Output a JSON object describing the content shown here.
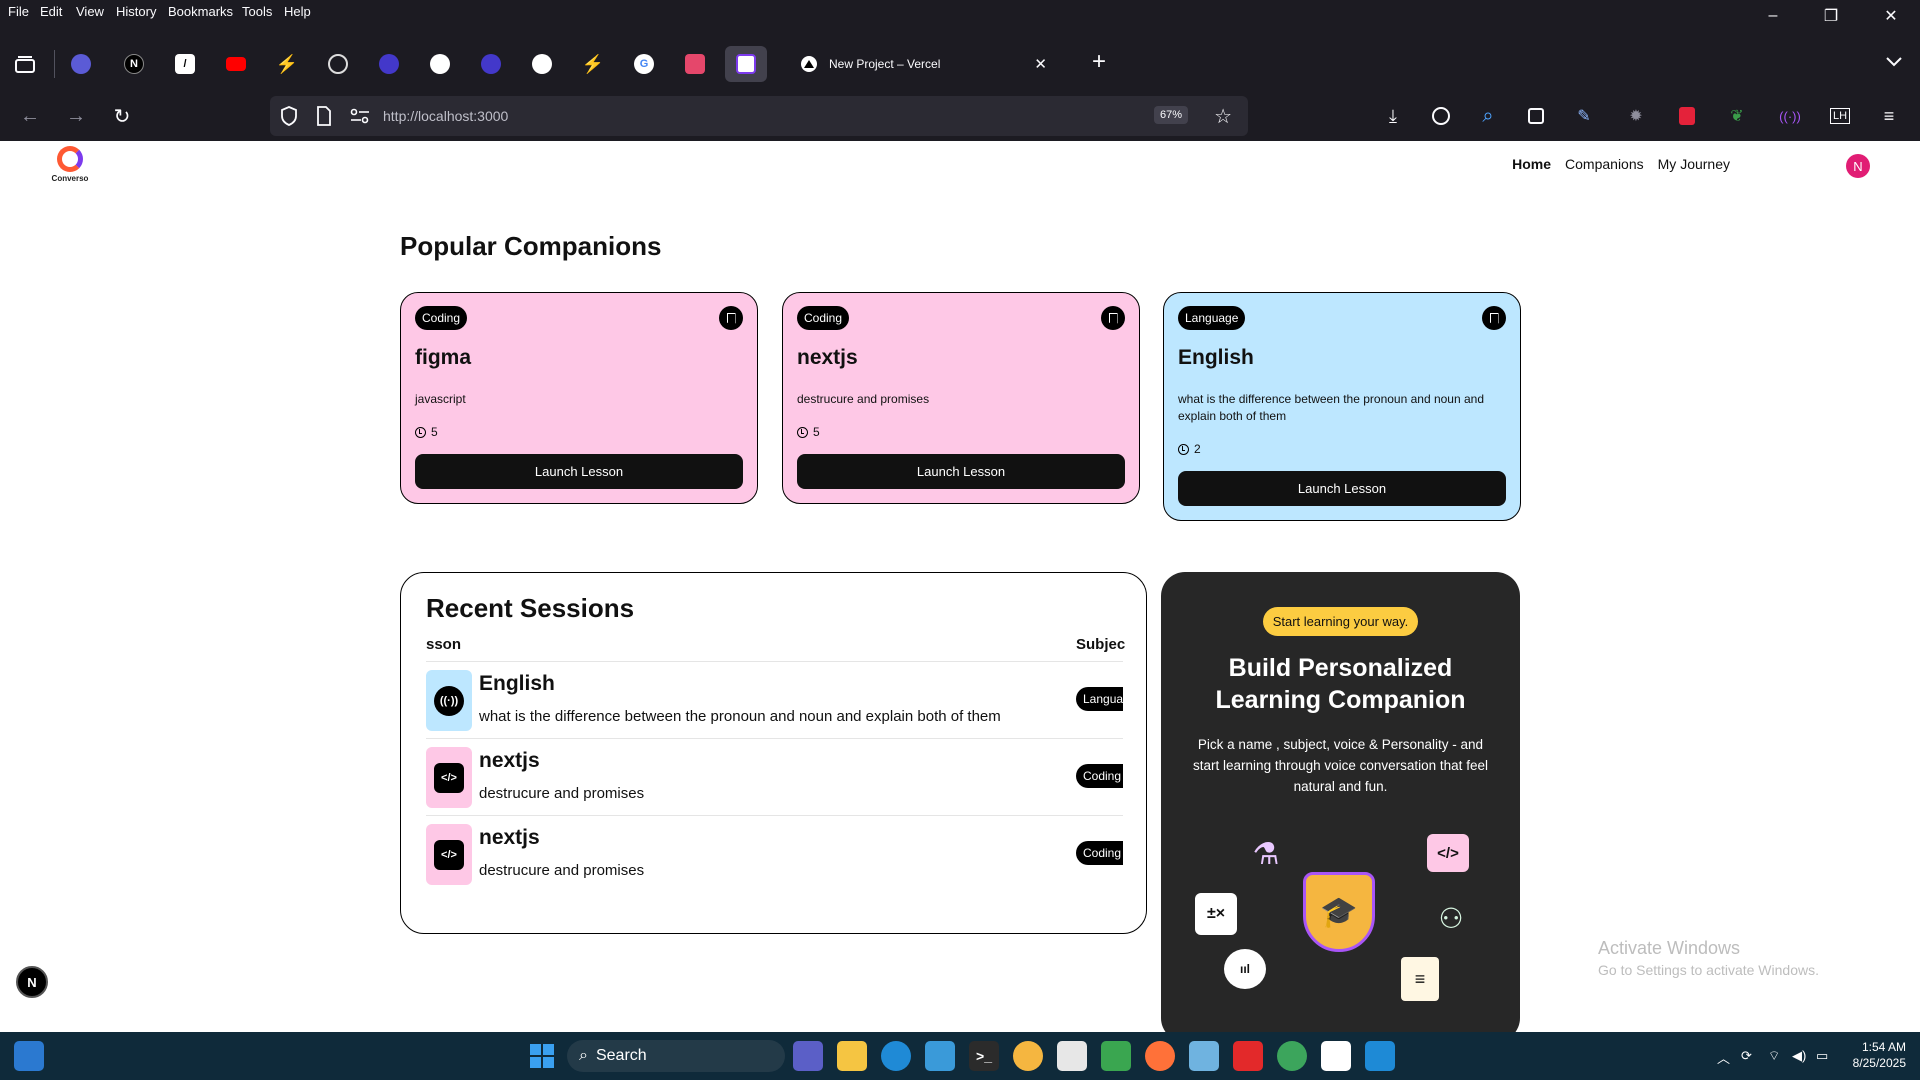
{
  "browser": {
    "menu": [
      "File",
      "Edit",
      "View",
      "History",
      "Bookmarks",
      "Tools",
      "Help"
    ],
    "window_controls": {
      "minimize": "–",
      "restore": "❐",
      "close": "✕"
    },
    "active_tab_title": "New Project – Vercel",
    "new_tab": "+",
    "url": "http://localhost:3000",
    "zoom": "67%",
    "pinned_tabs": [
      "N",
      "G"
    ],
    "toolbar_profile": "LH"
  },
  "site": {
    "logo_text": "Converso",
    "nav": [
      "Home",
      "Companions",
      "My Journey"
    ],
    "avatar_letter": "N"
  },
  "popular": {
    "title": "Popular Companions",
    "launch_label": "Launch Lesson",
    "cards": [
      {
        "subject": "Coding",
        "name": "figma",
        "topic": "javascript",
        "duration": "5",
        "color": "#fec8e6"
      },
      {
        "subject": "Coding",
        "name": "nextjs",
        "topic": "destrucure and promises",
        "duration": "5",
        "color": "#fec8e6"
      },
      {
        "subject": "Language",
        "name": "English",
        "topic": "what is the difference between the pronoun and noun and explain both of them",
        "duration": "2",
        "color": "#bde7ff"
      }
    ]
  },
  "recent": {
    "title": "Recent Sessions",
    "col_lesson": "sson",
    "col_subject": "Subjec",
    "rows": [
      {
        "name": "English",
        "topic": "what is the difference between the pronoun and noun and explain both of them",
        "subject": "Language",
        "icon": "chat-icon",
        "color": "#bde7ff",
        "glyph": "((·))"
      },
      {
        "name": "nextjs",
        "topic": "destrucure and promises",
        "subject": "Coding",
        "icon": "code-icon",
        "color": "#fec8e6",
        "glyph": "</>"
      },
      {
        "name": "nextjs",
        "topic": "destrucure and promises",
        "subject": "Coding",
        "icon": "code-icon",
        "color": "#fec8e6",
        "glyph": "</>"
      }
    ]
  },
  "cta": {
    "badge": "Start learning your way.",
    "title": "Build Personalized Learning Companion",
    "description": "Pick a name , subject, voice & Personality - and start learning through voice conversation that feel natural and fun."
  },
  "watermark": {
    "line1": "Activate Windows",
    "line2": "Go to Settings to activate Windows."
  },
  "dev_badge": "N",
  "taskbar": {
    "search_label": "Search",
    "time": "1:54 AM",
    "date": "8/25/2025"
  }
}
